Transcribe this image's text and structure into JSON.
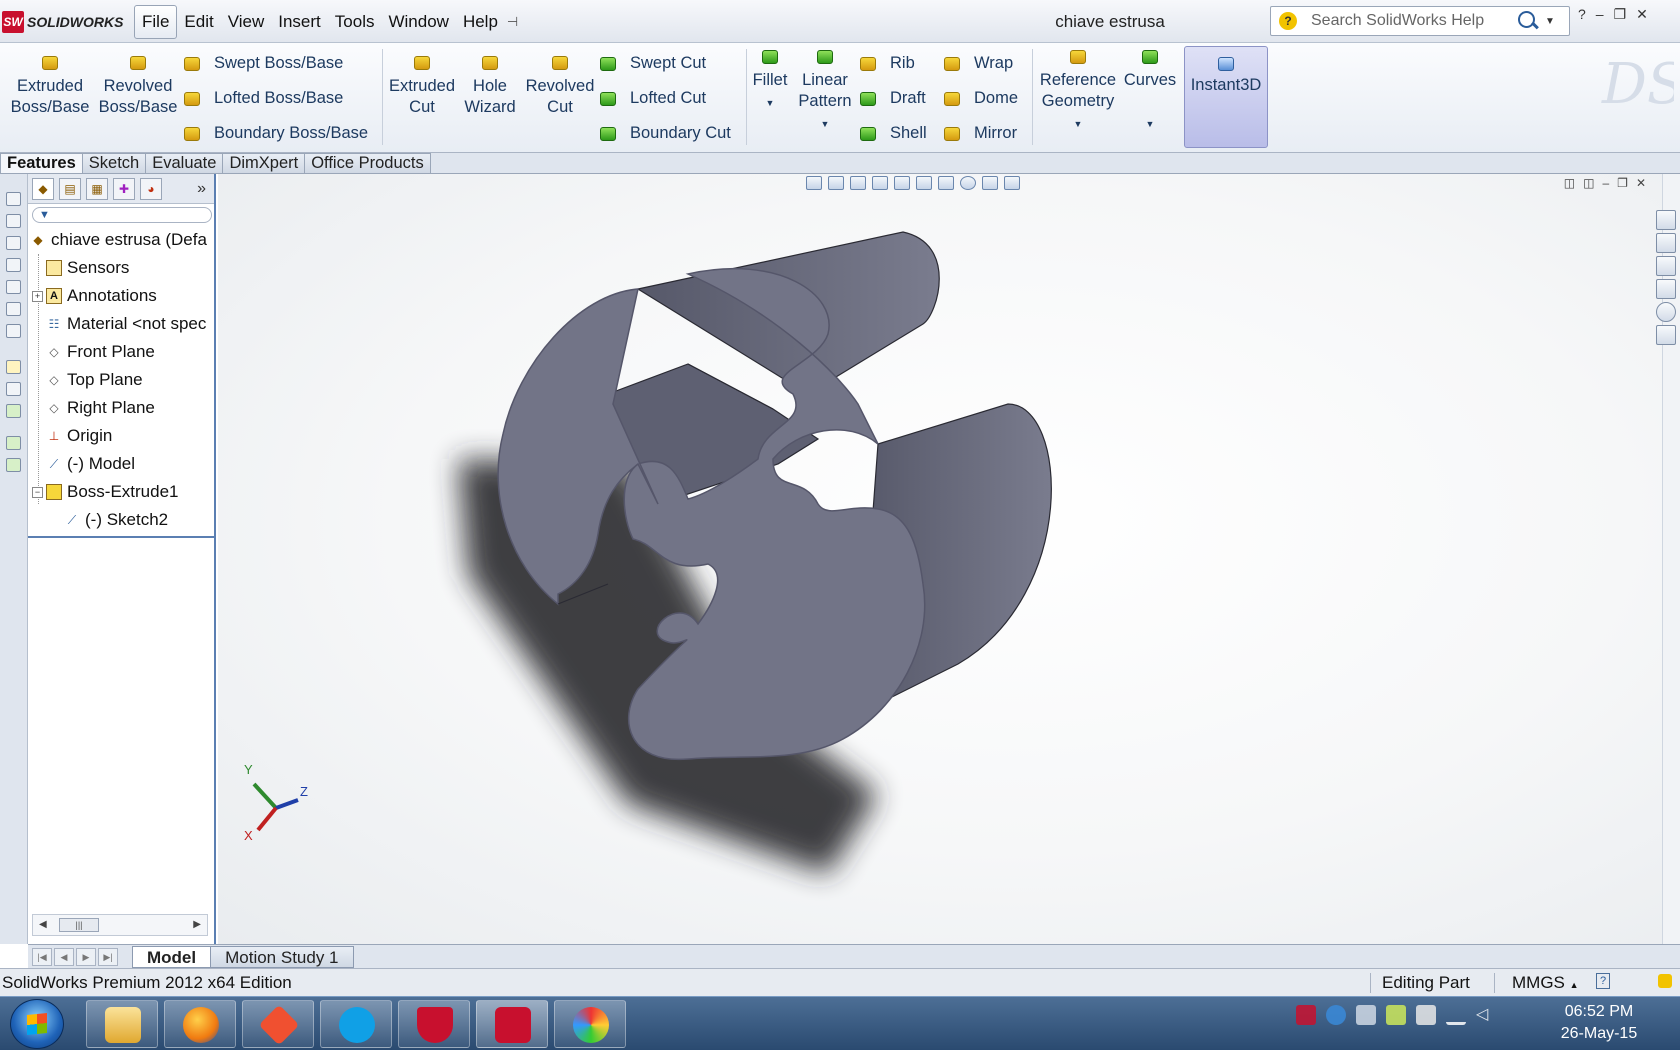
{
  "app": {
    "logo_text": "SOLIDWORKS",
    "document_title": "chiave estrusa"
  },
  "menu": [
    "File",
    "Edit",
    "View",
    "Insert",
    "Tools",
    "Window",
    "Help"
  ],
  "search": {
    "placeholder": "Search SolidWorks Help"
  },
  "window_controls": [
    "?",
    "–",
    "❐",
    "✕"
  ],
  "toolbar": {
    "extruded_boss": [
      "Extruded",
      "Boss/Base"
    ],
    "revolved_boss": [
      "Revolved",
      "Boss/Base"
    ],
    "swept_boss": "Swept Boss/Base",
    "lofted_boss": "Lofted Boss/Base",
    "boundary_boss": "Boundary Boss/Base",
    "extruded_cut": [
      "Extruded",
      "Cut"
    ],
    "hole_wizard": [
      "Hole",
      "Wizard"
    ],
    "revolved_cut": [
      "Revolved",
      "Cut"
    ],
    "swept_cut": "Swept Cut",
    "lofted_cut": "Lofted Cut",
    "boundary_cut": "Boundary Cut",
    "fillet": "Fillet",
    "linear_pattern": [
      "Linear",
      "Pattern"
    ],
    "rib": "Rib",
    "draft": "Draft",
    "shell": "Shell",
    "wrap": "Wrap",
    "dome": "Dome",
    "mirror": "Mirror",
    "reference_geometry": [
      "Reference",
      "Geometry"
    ],
    "curves": "Curves",
    "instant3d": "Instant3D"
  },
  "tabs": [
    "Features",
    "Sketch",
    "Evaluate",
    "DimXpert",
    "Office Products"
  ],
  "tree": {
    "root": "chiave estrusa  (Defa",
    "items": [
      {
        "label": "Sensors"
      },
      {
        "label": "Annotations"
      },
      {
        "label": "Material <not spec"
      },
      {
        "label": "Front Plane"
      },
      {
        "label": "Top Plane"
      },
      {
        "label": "Right Plane"
      },
      {
        "label": "Origin"
      },
      {
        "label": "(-) Model"
      },
      {
        "label": "Boss-Extrude1"
      },
      {
        "label": "(-) Sketch2"
      }
    ]
  },
  "triad": {
    "y": "Y",
    "z": "Z",
    "x": "X"
  },
  "bottom_tabs": [
    "Model",
    "Motion Study 1"
  ],
  "status": {
    "edition": "SolidWorks Premium 2012 x64 Edition",
    "editing": "Editing Part",
    "units": "MMGS"
  },
  "clock": {
    "time": "06:52 PM",
    "date": "26-May-15"
  },
  "colors": {
    "accent": "#5b7fb2",
    "model": "#727487",
    "brand": "#c8102e"
  }
}
